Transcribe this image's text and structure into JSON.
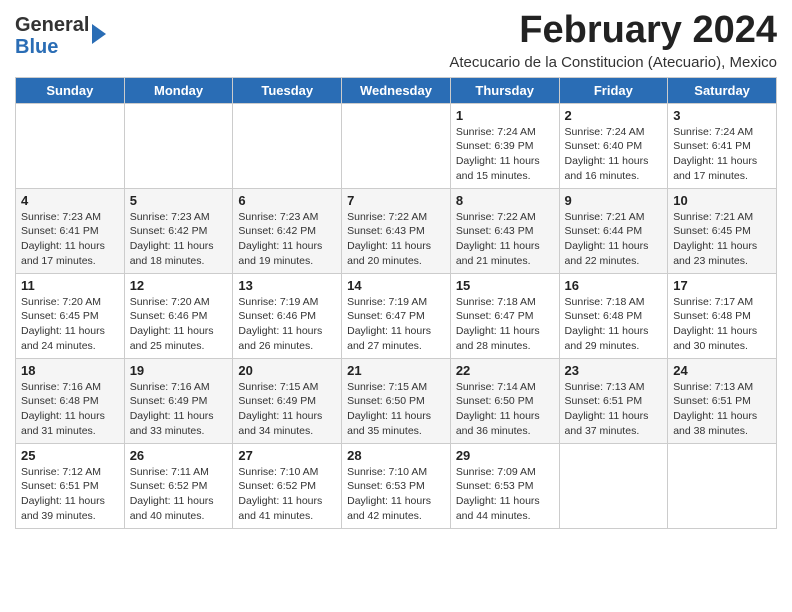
{
  "header": {
    "logo_general": "General",
    "logo_blue": "Blue",
    "month_title": "February 2024",
    "location": "Atecucario de la Constitucion (Atecuario), Mexico"
  },
  "weekdays": [
    "Sunday",
    "Monday",
    "Tuesday",
    "Wednesday",
    "Thursday",
    "Friday",
    "Saturday"
  ],
  "weeks": [
    [
      {
        "day": "",
        "info": ""
      },
      {
        "day": "",
        "info": ""
      },
      {
        "day": "",
        "info": ""
      },
      {
        "day": "",
        "info": ""
      },
      {
        "day": "1",
        "info": "Sunrise: 7:24 AM\nSunset: 6:39 PM\nDaylight: 11 hours and 15 minutes."
      },
      {
        "day": "2",
        "info": "Sunrise: 7:24 AM\nSunset: 6:40 PM\nDaylight: 11 hours and 16 minutes."
      },
      {
        "day": "3",
        "info": "Sunrise: 7:24 AM\nSunset: 6:41 PM\nDaylight: 11 hours and 17 minutes."
      }
    ],
    [
      {
        "day": "4",
        "info": "Sunrise: 7:23 AM\nSunset: 6:41 PM\nDaylight: 11 hours and 17 minutes."
      },
      {
        "day": "5",
        "info": "Sunrise: 7:23 AM\nSunset: 6:42 PM\nDaylight: 11 hours and 18 minutes."
      },
      {
        "day": "6",
        "info": "Sunrise: 7:23 AM\nSunset: 6:42 PM\nDaylight: 11 hours and 19 minutes."
      },
      {
        "day": "7",
        "info": "Sunrise: 7:22 AM\nSunset: 6:43 PM\nDaylight: 11 hours and 20 minutes."
      },
      {
        "day": "8",
        "info": "Sunrise: 7:22 AM\nSunset: 6:43 PM\nDaylight: 11 hours and 21 minutes."
      },
      {
        "day": "9",
        "info": "Sunrise: 7:21 AM\nSunset: 6:44 PM\nDaylight: 11 hours and 22 minutes."
      },
      {
        "day": "10",
        "info": "Sunrise: 7:21 AM\nSunset: 6:45 PM\nDaylight: 11 hours and 23 minutes."
      }
    ],
    [
      {
        "day": "11",
        "info": "Sunrise: 7:20 AM\nSunset: 6:45 PM\nDaylight: 11 hours and 24 minutes."
      },
      {
        "day": "12",
        "info": "Sunrise: 7:20 AM\nSunset: 6:46 PM\nDaylight: 11 hours and 25 minutes."
      },
      {
        "day": "13",
        "info": "Sunrise: 7:19 AM\nSunset: 6:46 PM\nDaylight: 11 hours and 26 minutes."
      },
      {
        "day": "14",
        "info": "Sunrise: 7:19 AM\nSunset: 6:47 PM\nDaylight: 11 hours and 27 minutes."
      },
      {
        "day": "15",
        "info": "Sunrise: 7:18 AM\nSunset: 6:47 PM\nDaylight: 11 hours and 28 minutes."
      },
      {
        "day": "16",
        "info": "Sunrise: 7:18 AM\nSunset: 6:48 PM\nDaylight: 11 hours and 29 minutes."
      },
      {
        "day": "17",
        "info": "Sunrise: 7:17 AM\nSunset: 6:48 PM\nDaylight: 11 hours and 30 minutes."
      }
    ],
    [
      {
        "day": "18",
        "info": "Sunrise: 7:16 AM\nSunset: 6:48 PM\nDaylight: 11 hours and 31 minutes."
      },
      {
        "day": "19",
        "info": "Sunrise: 7:16 AM\nSunset: 6:49 PM\nDaylight: 11 hours and 33 minutes."
      },
      {
        "day": "20",
        "info": "Sunrise: 7:15 AM\nSunset: 6:49 PM\nDaylight: 11 hours and 34 minutes."
      },
      {
        "day": "21",
        "info": "Sunrise: 7:15 AM\nSunset: 6:50 PM\nDaylight: 11 hours and 35 minutes."
      },
      {
        "day": "22",
        "info": "Sunrise: 7:14 AM\nSunset: 6:50 PM\nDaylight: 11 hours and 36 minutes."
      },
      {
        "day": "23",
        "info": "Sunrise: 7:13 AM\nSunset: 6:51 PM\nDaylight: 11 hours and 37 minutes."
      },
      {
        "day": "24",
        "info": "Sunrise: 7:13 AM\nSunset: 6:51 PM\nDaylight: 11 hours and 38 minutes."
      }
    ],
    [
      {
        "day": "25",
        "info": "Sunrise: 7:12 AM\nSunset: 6:51 PM\nDaylight: 11 hours and 39 minutes."
      },
      {
        "day": "26",
        "info": "Sunrise: 7:11 AM\nSunset: 6:52 PM\nDaylight: 11 hours and 40 minutes."
      },
      {
        "day": "27",
        "info": "Sunrise: 7:10 AM\nSunset: 6:52 PM\nDaylight: 11 hours and 41 minutes."
      },
      {
        "day": "28",
        "info": "Sunrise: 7:10 AM\nSunset: 6:53 PM\nDaylight: 11 hours and 42 minutes."
      },
      {
        "day": "29",
        "info": "Sunrise: 7:09 AM\nSunset: 6:53 PM\nDaylight: 11 hours and 44 minutes."
      },
      {
        "day": "",
        "info": ""
      },
      {
        "day": "",
        "info": ""
      }
    ]
  ]
}
